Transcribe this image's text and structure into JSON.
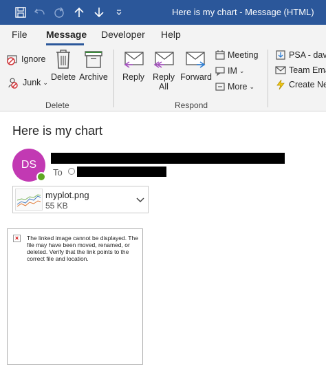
{
  "window": {
    "title": "Here is my chart  -  Message (HTML)",
    "titlebar_color": "#2b579a",
    "quick_access": [
      "save-icon",
      "undo-icon",
      "redo-icon",
      "up-arrow-icon",
      "down-arrow-icon",
      "customize-icon"
    ]
  },
  "menu": {
    "tabs": [
      {
        "label": "File"
      },
      {
        "label": "Message"
      },
      {
        "label": "Developer"
      },
      {
        "label": "Help"
      }
    ],
    "active_tab": "Message"
  },
  "ribbon": {
    "delete_group": {
      "label": "Delete",
      "ignore": "Ignore",
      "junk": "Junk",
      "delete": "Delete",
      "archive": "Archive"
    },
    "respond_group": {
      "label": "Respond",
      "reply": "Reply",
      "reply_all_line1": "Reply",
      "reply_all_line2": "All",
      "forward": "Forward",
      "meeting": "Meeting",
      "im": "IM",
      "more": "More"
    },
    "quick_steps": {
      "psa": "PSA - dav",
      "team_email": "Team Ema",
      "create_new": "Create Ne"
    }
  },
  "message": {
    "subject": "Here is my chart",
    "sender_initials": "DS",
    "avatar_color": "#c239b3",
    "to_label": "To",
    "attachment": {
      "name": "myplot.png",
      "size": "55 KB"
    },
    "broken_image_text": "The linked image cannot be displayed.  The file may have been moved, renamed, or deleted. Verify that the link points to the correct file and location."
  }
}
